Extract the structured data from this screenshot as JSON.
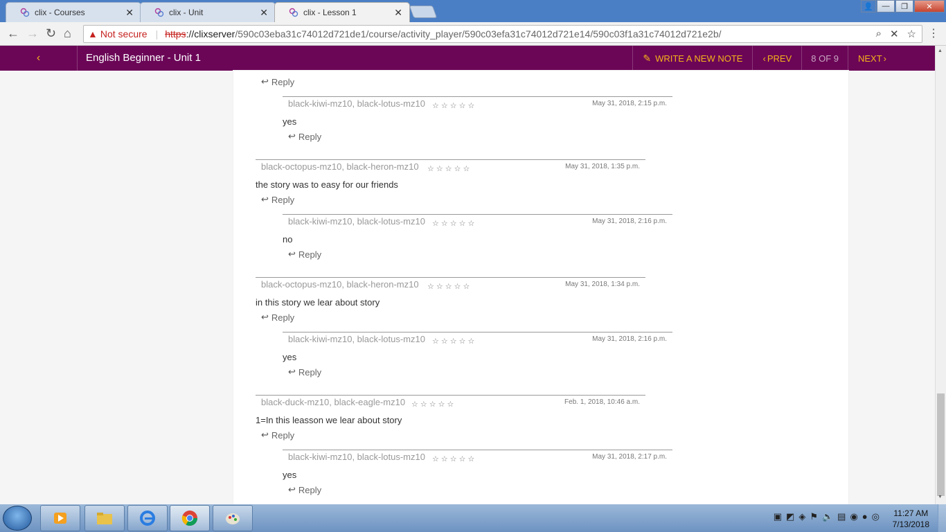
{
  "browser": {
    "tabs": [
      {
        "title": "clix - Courses"
      },
      {
        "title": "clix - Unit"
      },
      {
        "title": "clix - Lesson 1"
      }
    ],
    "security_label": "Not secure",
    "url_scheme": "https",
    "url_host": "://clixserver",
    "url_path": "/590c03eba31c74012d721de1/course/activity_player/590c03efa31c74012d721e14/590c03f1a31c74012d721e2b/"
  },
  "app": {
    "title": "English Beginner - Unit 1",
    "write_note_label": "WRITE A NEW NOTE",
    "prev_label": "PREV",
    "page_counter": "8 OF 9",
    "next_label": "NEXT"
  },
  "notes": {
    "partial_reply_label": "Reply",
    "threads": [
      {
        "authors": "black-octopus-mz10, black-heron-mz10",
        "date": "May 31, 2018, 1:35 p.m.",
        "text": "the story was to easy for our friends",
        "reply_label": "Reply",
        "child": {
          "authors": "black-kiwi-mz10, black-lotus-mz10",
          "date": "May 31, 2018, 2:16 p.m.",
          "text": "no",
          "reply_label": "Reply"
        }
      },
      {
        "authors": "black-octopus-mz10, black-heron-mz10",
        "date": "May 31, 2018, 1:34 p.m.",
        "text": "in this story we lear about story",
        "reply_label": "Reply",
        "child": {
          "authors": "black-kiwi-mz10, black-lotus-mz10",
          "date": "May 31, 2018, 2:16 p.m.",
          "text": "yes",
          "reply_label": "Reply"
        }
      },
      {
        "authors": "black-duck-mz10, black-eagle-mz10",
        "date": "Feb. 1, 2018, 10:46 a.m.",
        "text": "1=In this leasson we lear about story",
        "reply_label": "Reply",
        "child": {
          "authors": "black-kiwi-mz10, black-lotus-mz10",
          "date": "May 31, 2018, 2:17 p.m.",
          "text": "yes",
          "reply_label": "Reply"
        }
      }
    ],
    "first_child": {
      "authors": "black-kiwi-mz10, black-lotus-mz10",
      "date": "May 31, 2018, 2:15 p.m.",
      "text": "yes",
      "reply_label": "Reply"
    },
    "star_glyphs": "☆☆☆☆☆"
  },
  "taskbar": {
    "time": "11:27 AM",
    "date": "7/13/2018"
  },
  "colors": {
    "app_bar": "#6b0657",
    "accent": "#f5b21a"
  }
}
